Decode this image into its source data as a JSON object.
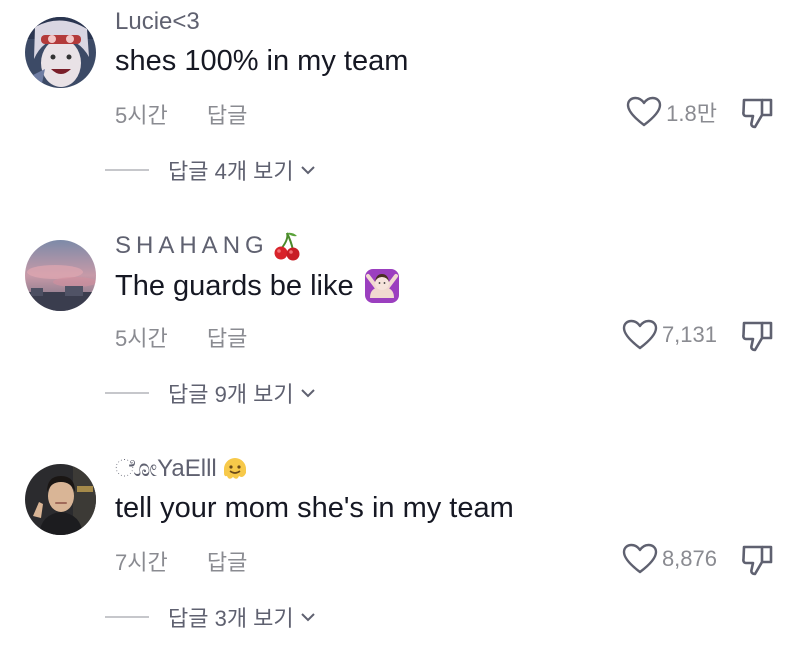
{
  "comments": [
    {
      "username": "Lucie<3",
      "text": "shes 100% in my team",
      "time": "5시간",
      "reply_label": "답글",
      "likes": "1.8만",
      "view_replies": "답글 4개 보기",
      "avatar_icon": "anime-girl-avatar"
    },
    {
      "username": "SHAHANG",
      "username_emoji": "cherries-emoji",
      "text": "The guards be like",
      "text_emoji": "person-gesturing-no-emoji",
      "time": "5시간",
      "reply_label": "답글",
      "likes": "7,131",
      "view_replies": "답글 9개 보기",
      "avatar_icon": "sunset-sky-avatar"
    },
    {
      "username": "ೋYaElll",
      "username_emoji": "melting-face-emoji",
      "text": "tell your mom she's in my team",
      "time": "7시간",
      "reply_label": "답글",
      "likes": "8,876",
      "view_replies": "답글 3개 보기",
      "avatar_icon": "man-photo-avatar"
    }
  ],
  "colors": {
    "text_primary": "#161823",
    "text_secondary": "#8a8b91",
    "username": "#5f6170",
    "divider": "#c6c7cb"
  }
}
